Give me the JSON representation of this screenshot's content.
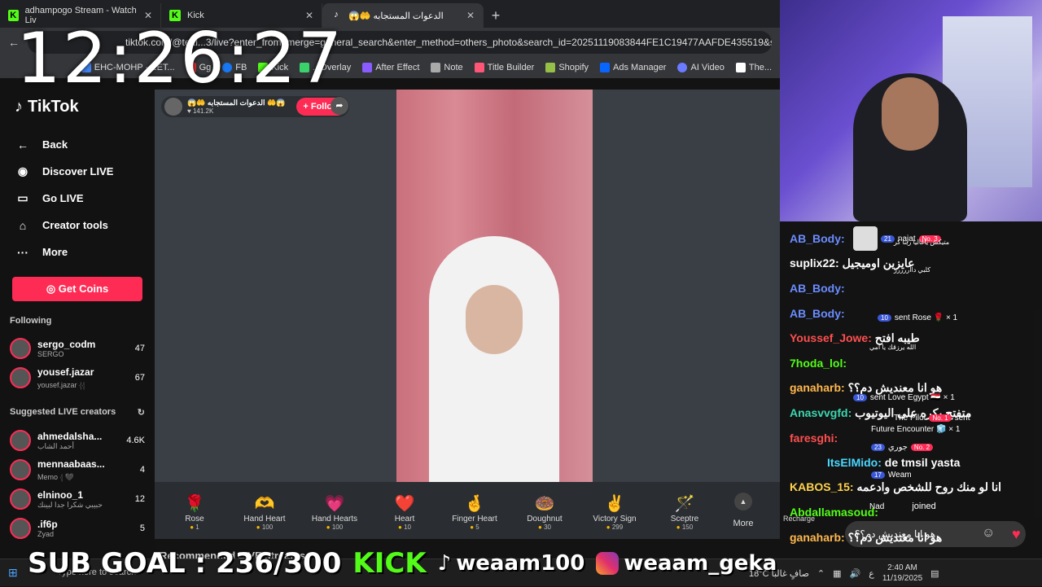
{
  "browser": {
    "tabs": [
      {
        "label": "adhampogo Stream - Watch Liv",
        "icon": "kick"
      },
      {
        "label": "Kick",
        "icon": "kick"
      },
      {
        "label": "😱🤲 الدعوات المستجابه",
        "icon": "tiktok"
      }
    ],
    "url": "tiktok.com/@tetti...3/live?enter_from_merge=general_search&enter_method=others_photo&search_id=20251119083844FE1C19477AAFDE435519&search_keyw",
    "bookmarks": [
      "EHC-MOHP - EET...",
      "Gg",
      "FB",
      "Kick",
      "...Overlay",
      "After Effect",
      "Note",
      "Title Builder",
      "Shopify",
      "Ads Manager",
      "AI Video",
      "The..."
    ]
  },
  "clock": "12:26:27",
  "sidebar": {
    "brand": "TikTok",
    "nav": [
      {
        "label": "Back",
        "icon": "back-arrow-icon"
      },
      {
        "label": "Discover LIVE",
        "icon": "live-icon"
      },
      {
        "label": "Go LIVE",
        "icon": "camera-icon"
      },
      {
        "label": "Creator tools",
        "icon": "home-icon"
      },
      {
        "label": "More",
        "icon": "dots-icon"
      }
    ],
    "coins_button": "Get Coins",
    "following_title": "Following",
    "following": [
      {
        "name": "sergo_codm",
        "sub": "SERGO",
        "count": "47"
      },
      {
        "name": "yousef.jazar",
        "sub": "yousef.jazar 𓂆𓂆",
        "count": "67"
      }
    ],
    "suggested_title": "Suggested LIVE creators",
    "suggested": [
      {
        "name": "ahmedalsha...",
        "sub": "أحمد الشاب",
        "count": "4.6K"
      },
      {
        "name": "mennaabaas...",
        "sub": "Memo 𓂆 🖤",
        "count": "4"
      },
      {
        "name": "elninoo_1",
        "sub": "حبيبي شكرا جدا لبينك",
        "count": "12"
      },
      {
        "name": ".if6p",
        "sub": "Zyad",
        "count": "5"
      }
    ]
  },
  "stream": {
    "host_name": "😱🤲 الدعوات المستجابه 🤲😱",
    "host_viewers": "141.2K",
    "follow_label": "+ Follow",
    "gifts": [
      {
        "name": "Rose",
        "price": "1",
        "icon": "🌹"
      },
      {
        "name": "Hand Heart",
        "price": "100",
        "icon": "🫶"
      },
      {
        "name": "Hand Hearts",
        "price": "100",
        "icon": "💗"
      },
      {
        "name": "Heart",
        "price": "10",
        "icon": "❤️"
      },
      {
        "name": "Finger Heart",
        "price": "5",
        "icon": "🤞"
      },
      {
        "name": "Doughnut",
        "price": "30",
        "icon": "🍩"
      },
      {
        "name": "Victory Sign",
        "price": "299",
        "icon": "✌️"
      },
      {
        "name": "Sceptre",
        "price": "150",
        "icon": "🪄"
      }
    ],
    "more_label": "More",
    "recommended": "Recommended LIVE streams"
  },
  "chat": {
    "messages": [
      {
        "user": "AB_Body:",
        "text": "",
        "color": "#6b8cff"
      },
      {
        "user": "suplix22:",
        "text": "عايزين اوميجيل",
        "color": "#ffffff"
      },
      {
        "user": "AB_Body:",
        "text": "",
        "color": "#6b8cff"
      },
      {
        "user": "AB_Body:",
        "text": "",
        "color": "#6b8cff"
      },
      {
        "user": "Youssef_Jowe:",
        "text": "طيبه افتح",
        "color": "#ff4f4f"
      },
      {
        "user": "7hoda_lol:",
        "text": "",
        "color": "#53fc18"
      },
      {
        "user": "ganaharb:",
        "text": "هو انا معنديش دم؟؟",
        "color": "#ffb84d"
      },
      {
        "user": "Anasvvgfd:",
        "text": "متفتح بكره على اليوتيوب",
        "color": "#3cd6b0"
      },
      {
        "user": "faresghi:",
        "text": "",
        "color": "#ff4f4f"
      },
      {
        "user": "ItsElMido:",
        "text": "de tmsil yasta",
        "color": "#ffffff"
      },
      {
        "user": "KABOS_15:",
        "text": "انا لو منك روح للشخص وادعمه",
        "color": "#ffd24d"
      },
      {
        "user": "Abdallamasoud:",
        "text": "",
        "color": "#53fc18"
      },
      {
        "user": "ganaharb:",
        "text": "هو انا معنديش دم؟؟",
        "color": "#ffb84d"
      }
    ],
    "tiktok_events": [
      {
        "user": "najat",
        "lvl": "21",
        "badge": "No. 3",
        "text": "متيكش ياغاليا ربنا كر"
      },
      {
        "user": "",
        "lvl": "",
        "badge": "",
        "text": "كلبي دااررررر"
      },
      {
        "user": "",
        "lvl": "10",
        "badge": "",
        "text": "sent Rose 🌹 × 1"
      },
      {
        "user": "",
        "lvl": "",
        "badge": "",
        "text": "الله يرزقك يا امي"
      },
      {
        "user": "",
        "lvl": "10",
        "badge": "",
        "text": "sent Love Egypt 🇪🇬 × 1"
      },
      {
        "user": "The Pilot",
        "lvl": "",
        "badge": "No. 1",
        "text": "sent"
      },
      {
        "user": "",
        "lvl": "",
        "badge": "",
        "text": "Future Encounter 🧊 × 1"
      },
      {
        "user": "جوري",
        "lvl": "23",
        "badge": "No. 2",
        "text": ""
      },
      {
        "user": "Weam",
        "lvl": "17",
        "badge": "",
        "text": ""
      },
      {
        "user": "Nad",
        "lvl": "",
        "badge": "",
        "text": "joined"
      }
    ],
    "input_value": "هو انا معنديش دم؟؟",
    "recharge": "Recharge"
  },
  "overlay": {
    "sub_goal": "SUB GOAL : 236/300",
    "kick_text": "KICK",
    "tiktok_handle": "weaam100",
    "instagram_handle": "weaam_geka"
  },
  "taskbar": {
    "search": "Type here to search",
    "weather": "18°C صافٍ غالبًا",
    "lang": "ع",
    "time": "2:40 AM",
    "date": "11/19/2025"
  },
  "colors": {
    "accent": "#fe2c55",
    "kick": "#53fc18"
  }
}
